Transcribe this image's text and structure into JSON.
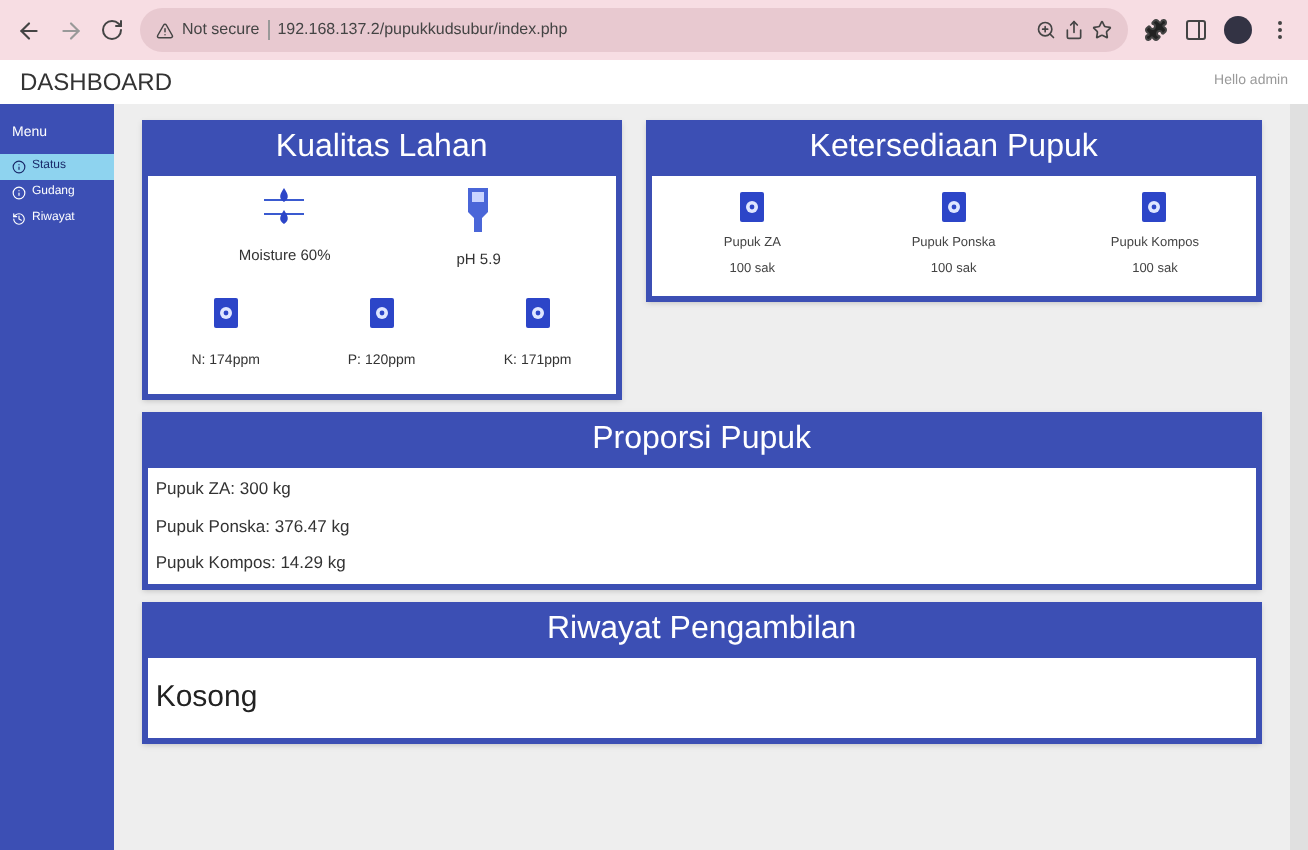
{
  "browser": {
    "security": "Not secure",
    "url": "192.168.137.2/pupukkudsubur/index.php"
  },
  "header": {
    "title": "DASHBOARD",
    "greeting": "Hello admin"
  },
  "sidebar": {
    "heading": "Menu",
    "items": [
      {
        "label": "Status",
        "kind": "info",
        "selected": true
      },
      {
        "label": "Gudang",
        "kind": "info",
        "selected": false
      },
      {
        "label": "Riwayat",
        "kind": "history",
        "selected": false
      }
    ]
  },
  "kualitas_lahan": {
    "title": "Kualitas Lahan",
    "sensors": [
      {
        "kind": "moisture",
        "label": "Moisture 60%"
      },
      {
        "kind": "ph",
        "label": "pH 5.9"
      }
    ],
    "nutrients": [
      "N: 174ppm",
      "P: 120ppm",
      "K: 171ppm"
    ]
  },
  "ketersediaan_pupuk": {
    "title": "Ketersediaan Pupuk",
    "items": [
      {
        "name": "Pupuk ZA",
        "amount": "100 sak"
      },
      {
        "name": "Pupuk Ponska",
        "amount": "100 sak"
      },
      {
        "name": "Pupuk Kompos",
        "amount": "100 sak"
      }
    ]
  },
  "proporsi_pupuk": {
    "title": "Proporsi Pupuk",
    "lines": [
      "Pupuk ZA: 300 kg",
      "Pupuk Ponska: 376.47 kg",
      "Pupuk Kompos: 14.29 kg"
    ]
  },
  "riwayat": {
    "title": "Riwayat Pengambilan",
    "text": "Kosong"
  }
}
